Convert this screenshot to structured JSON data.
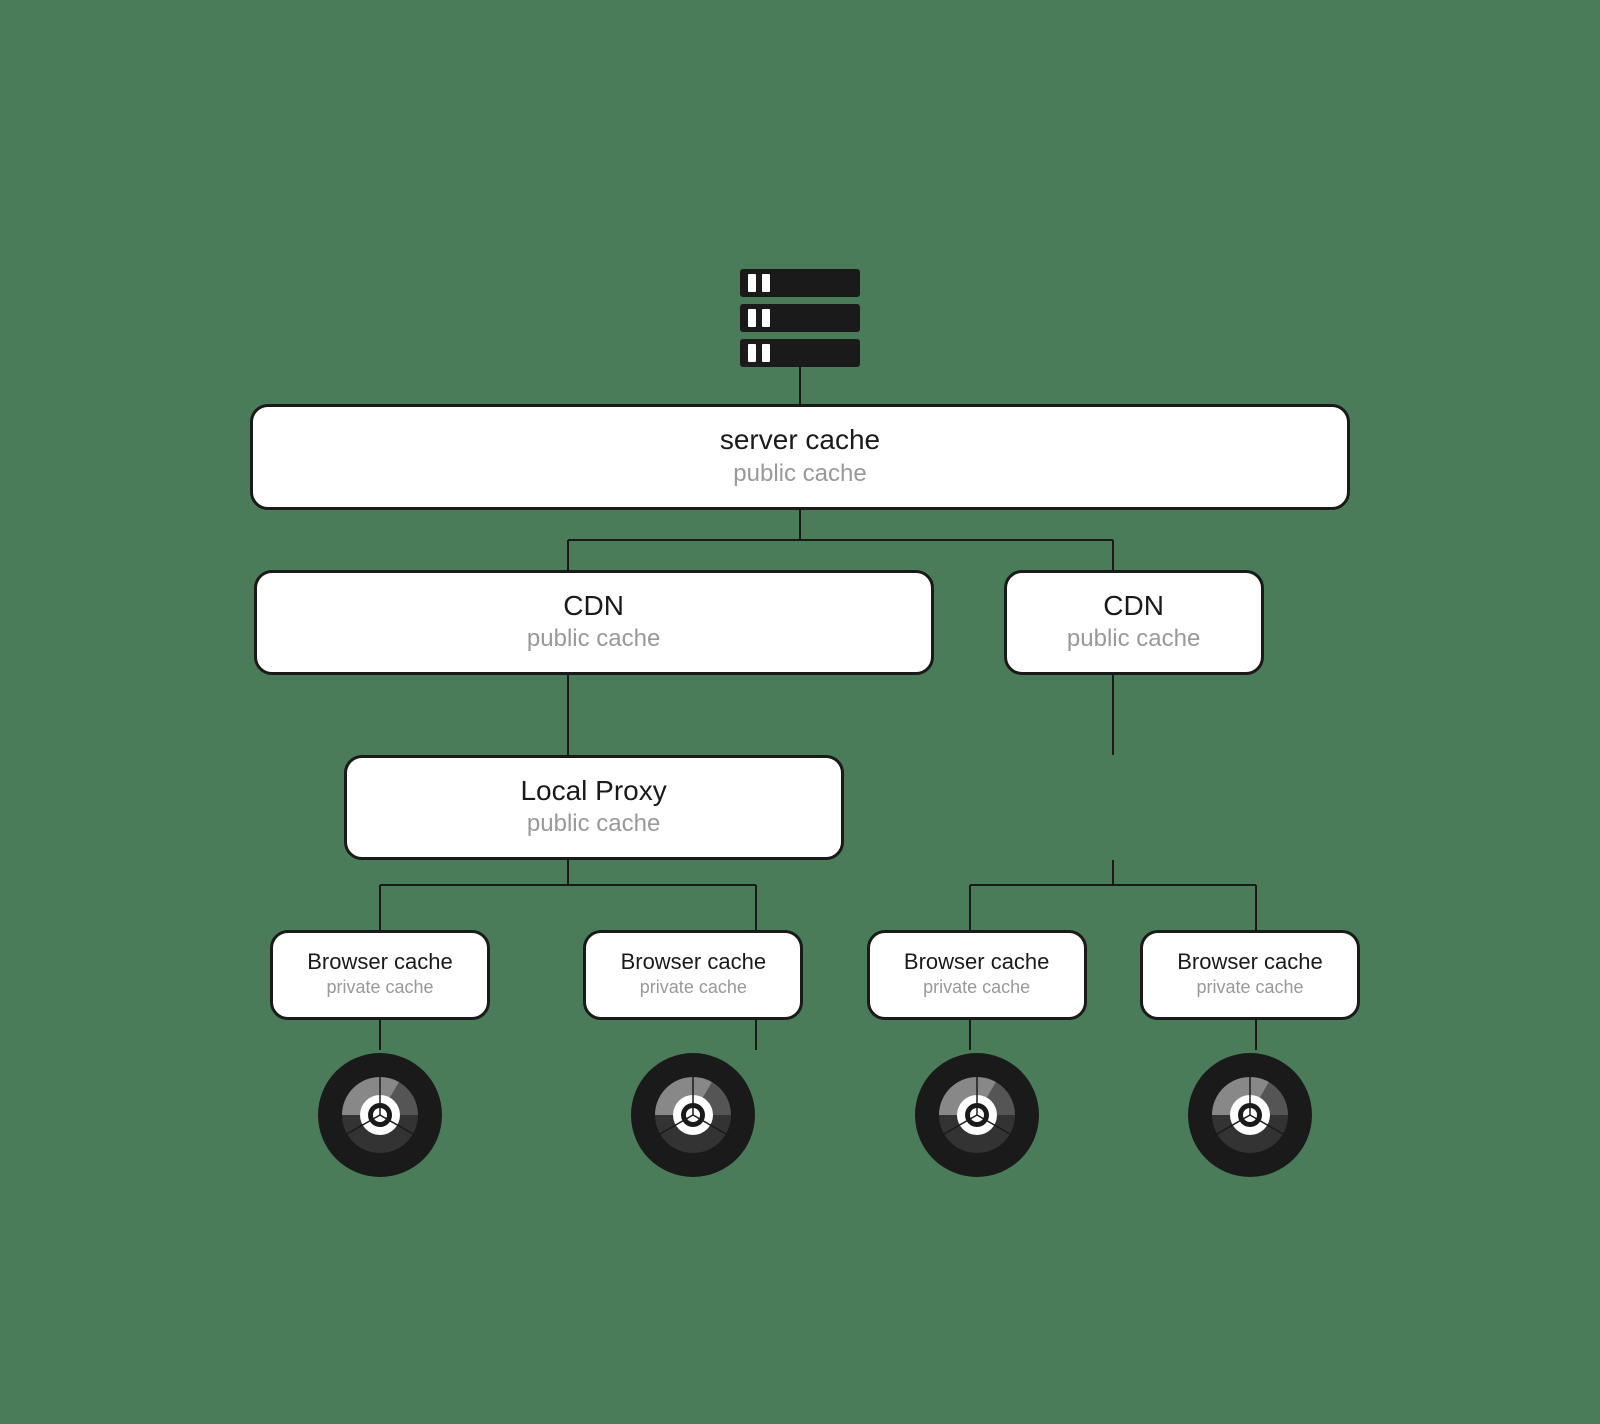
{
  "diagram": {
    "background_color": "#4a7c59",
    "server_cache": {
      "title": "server cache",
      "subtitle": "public cache"
    },
    "cdn_left": {
      "title": "CDN",
      "subtitle": "public cache"
    },
    "cdn_right": {
      "title": "CDN",
      "subtitle": "public cache"
    },
    "local_proxy": {
      "title": "Local Proxy",
      "subtitle": "public cache"
    },
    "browser_caches": [
      {
        "title": "Browser cache",
        "subtitle": "private cache"
      },
      {
        "title": "Browser cache",
        "subtitle": "private cache"
      },
      {
        "title": "Browser cache",
        "subtitle": "private cache"
      },
      {
        "title": "Browser cache",
        "subtitle": "private cache"
      }
    ]
  }
}
